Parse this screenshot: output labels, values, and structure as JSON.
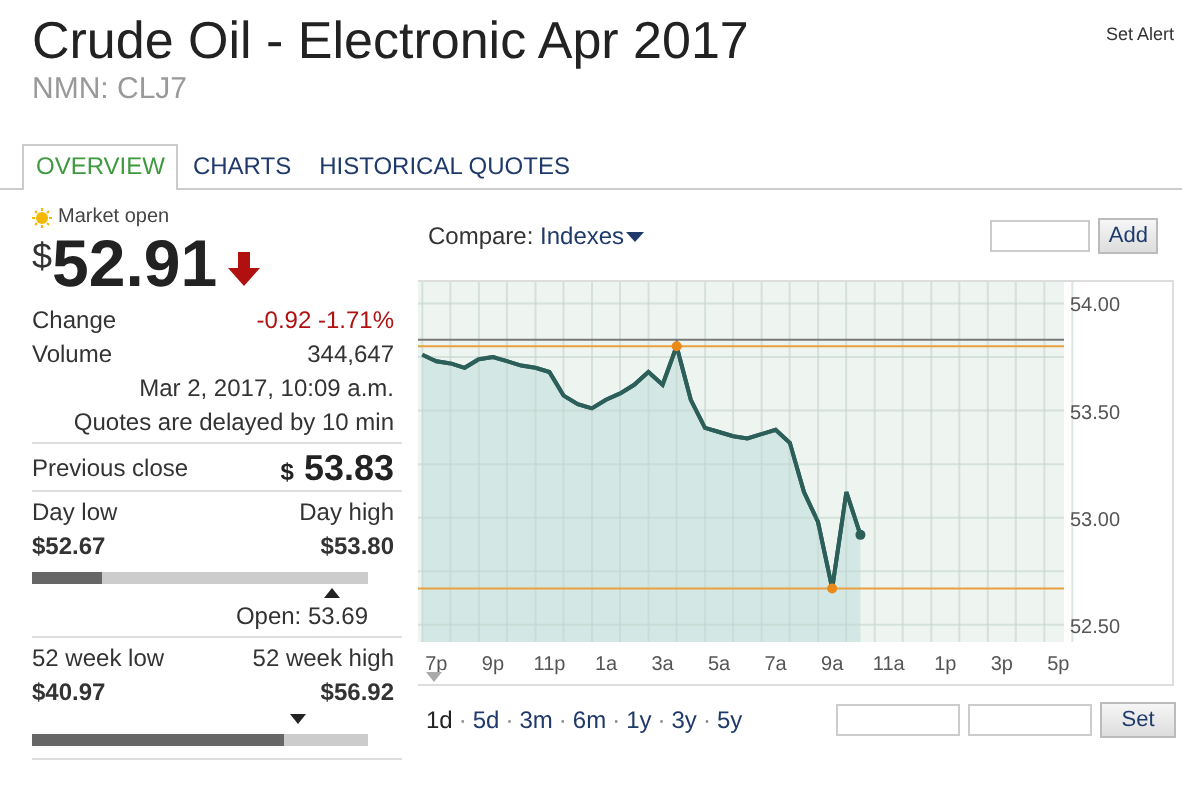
{
  "header": {
    "title": "Crude Oil - Electronic Apr 2017",
    "symbol": "NMN: CLJ7",
    "alert_link": "Set Alert"
  },
  "tabs": [
    {
      "label": "OVERVIEW",
      "selected": true
    },
    {
      "label": "CHARTS",
      "selected": false
    },
    {
      "label": "HISTORICAL QUOTES",
      "selected": false
    }
  ],
  "quote": {
    "status": "Market open",
    "currency": "$",
    "price": "52.91",
    "change_label": "Change",
    "change": "-0.92 -1.71%",
    "volume_label": "Volume",
    "volume": "344,647",
    "timestamp": "Mar 2, 2017, 10:09 a.m.",
    "delay_note": "Quotes are delayed by 10 min",
    "previous_close": {
      "label": "Previous close",
      "currency": "$",
      "value": "53.83"
    },
    "day_range": {
      "low_label": "Day low",
      "high_label": "Day high",
      "low": "$52.67",
      "high": "$53.80",
      "level": 0.21,
      "open": "Open: 53.69"
    },
    "week52_range": {
      "low_label": "52 week low",
      "high_label": "52 week high",
      "low": "$40.97",
      "high": "$56.92",
      "level": 0.75
    }
  },
  "compare": {
    "label": "Compare:",
    "menu": "Indexes",
    "add_button": "Add"
  },
  "chart": {
    "chart_data": {
      "type": "area",
      "grid": true,
      "ylim": [
        52.42,
        54.1
      ],
      "ref_lines": [
        {
          "axis": "y",
          "value": 53.83,
          "color": "#777777"
        },
        {
          "axis": "y",
          "value": 53.8,
          "color": "#e8a040"
        },
        {
          "axis": "y",
          "value": 52.67,
          "color": "#e8a040"
        }
      ],
      "categories": [
        null,
        "7p",
        null,
        null,
        null,
        "9p",
        null,
        null,
        null,
        "11p",
        null,
        null,
        null,
        "1a",
        null,
        null,
        null,
        "3a",
        null,
        null,
        null,
        "5a",
        null,
        null,
        null,
        "7a",
        null,
        null,
        null,
        "9a",
        null,
        null,
        null,
        "11a",
        null,
        null,
        null,
        "1p",
        null,
        null,
        null,
        "3p",
        null,
        null,
        null,
        "5p"
      ],
      "yticks": [
        {
          "value": 52.5,
          "label": "52.50"
        },
        {
          "value": 53,
          "label": "53.00"
        },
        {
          "value": 53.5,
          "label": "53.50"
        },
        {
          "value": 54,
          "label": "54.00"
        }
      ],
      "series": [
        {
          "color": "#2d5f5a",
          "values": [
            53.76,
            53.73,
            53.72,
            53.7,
            53.74,
            53.75,
            53.73,
            53.71,
            53.7,
            53.68,
            53.57,
            53.53,
            53.51,
            53.55,
            53.58,
            53.62,
            53.68,
            53.62,
            53.8,
            53.55,
            53.42,
            53.4,
            53.38,
            53.37,
            53.39,
            53.41,
            53.35,
            53.12,
            52.98,
            52.67,
            53.12,
            52.92,
            null,
            null,
            null,
            null,
            null,
            null,
            null,
            null,
            null,
            null,
            null,
            null,
            null,
            null
          ]
        }
      ]
    }
  },
  "ranges": {
    "separator": "·",
    "items": [
      {
        "label": "1d",
        "selected": true
      },
      {
        "label": "5d",
        "selected": false
      },
      {
        "label": "3m",
        "selected": false
      },
      {
        "label": "6m",
        "selected": false
      },
      {
        "label": "1y",
        "selected": false
      },
      {
        "label": "3y",
        "selected": false
      },
      {
        "label": "5y",
        "selected": false
      }
    ],
    "set_button": "Set"
  }
}
